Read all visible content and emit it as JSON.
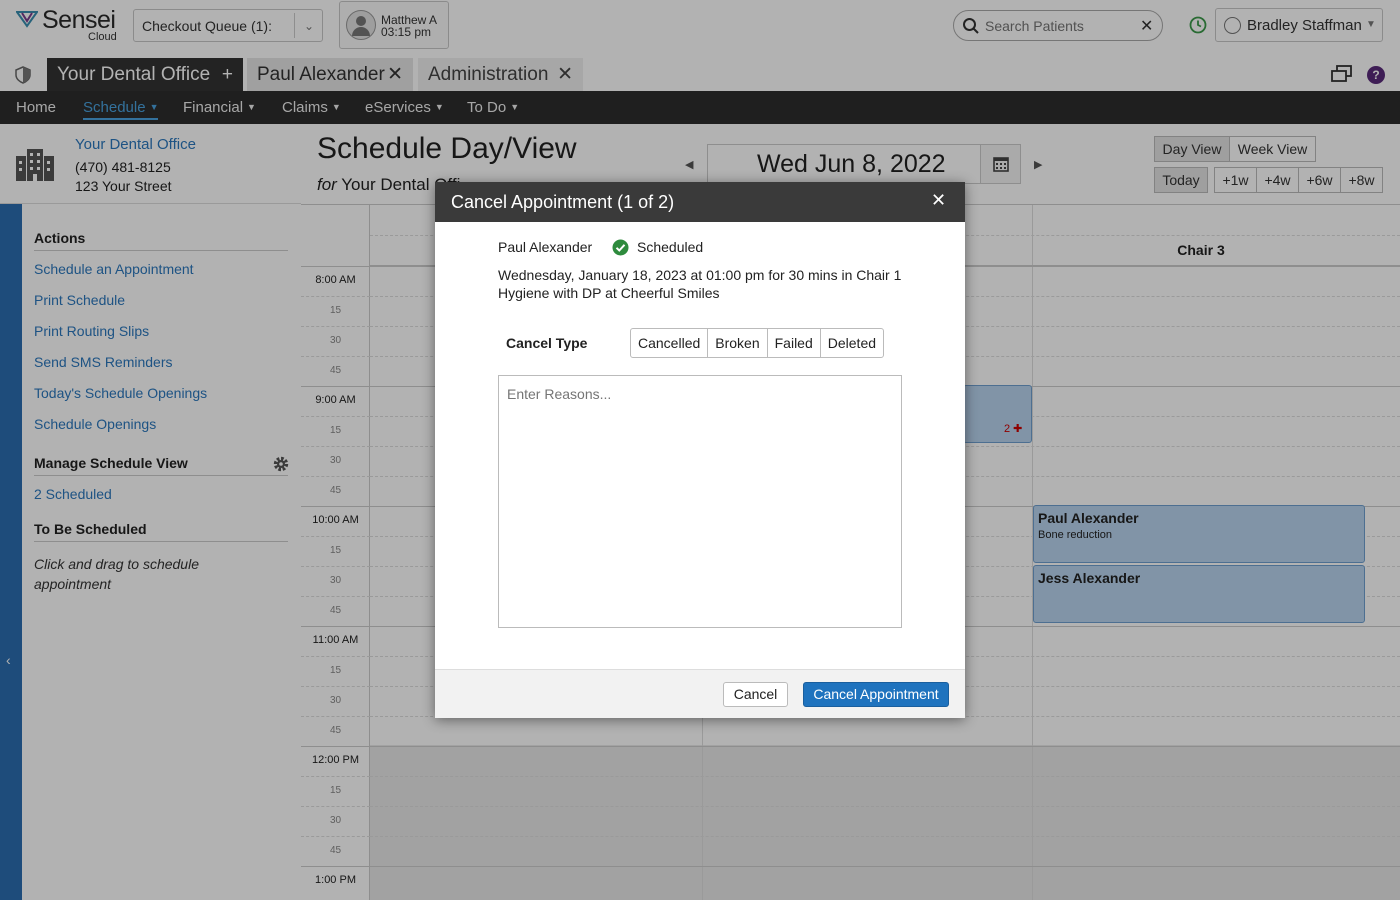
{
  "app": {
    "name": "Sensei",
    "sub": "Cloud"
  },
  "topbar": {
    "queue_label": "Checkout Queue (1):",
    "user_name": "Matthew A",
    "user_time": "03:15 pm",
    "search_placeholder": "Search Patients",
    "staff_name": "Bradley Staffman"
  },
  "tabs": [
    {
      "label": "Your Dental Office",
      "action": "+"
    },
    {
      "label": "Paul Alexander",
      "action": "✕"
    },
    {
      "label": "Administration",
      "action": "✕"
    }
  ],
  "nav": [
    "Home",
    "Schedule",
    "Financial",
    "Claims",
    "eServices",
    "To Do"
  ],
  "office": {
    "name": "Your Dental Office",
    "phone": "(470) 481-8125",
    "street": "123 Your Street"
  },
  "sidebar": {
    "actions_title": "Actions",
    "actions": [
      "Schedule an Appointment",
      "Print Schedule",
      "Print Routing Slips",
      "Send SMS Reminders",
      "Today's Schedule Openings",
      "Schedule Openings"
    ],
    "manage_title": "Manage Schedule View",
    "scheduled": "2 Scheduled",
    "tbs_title": "To Be Scheduled",
    "tbs_hint": "Click and drag to schedule appointment"
  },
  "schedule": {
    "title": "Schedule Day/View",
    "for_word": "for",
    "for_office": "Your Dental Offi",
    "date": "Wed Jun 8, 2022",
    "views": [
      "Day View",
      "Week View"
    ],
    "jumps": [
      "Today",
      "+1w",
      "+4w",
      "+6w",
      "+8w"
    ],
    "chair_label": "Chair 3",
    "times": [
      "8:00 AM",
      "15",
      "30",
      "45",
      "9:00 AM",
      "15",
      "30",
      "45",
      "10:00 AM",
      "15",
      "30",
      "45",
      "11:00 AM",
      "15",
      "30",
      "45",
      "12:00 PM",
      "15",
      "30",
      "45",
      "1:00 PM"
    ],
    "badge_count": "2",
    "appointments": [
      {
        "name": "Paul Alexander",
        "procedure": "Bone reduction"
      },
      {
        "name": "Jess Alexander",
        "procedure": ""
      }
    ]
  },
  "modal": {
    "title": "Cancel Appointment (1 of 2)",
    "patient": "Paul Alexander",
    "status": "Scheduled",
    "description": "Wednesday, January 18, 2023 at 01:00 pm for 30 mins in Chair 1 Hygiene with DP at Cheerful Smiles",
    "cancel_type_label": "Cancel Type",
    "cancel_types": [
      "Cancelled",
      "Broken",
      "Failed",
      "Deleted"
    ],
    "reason_placeholder": "Enter Reasons...",
    "cancel_button": "Cancel",
    "confirm_button": "Cancel Appointment"
  },
  "colors": {
    "accent": "#1f73be",
    "nav_bg": "#2d2d2d",
    "appt_bg": "#b9d5ef",
    "status_ok": "#2e8b3d"
  }
}
